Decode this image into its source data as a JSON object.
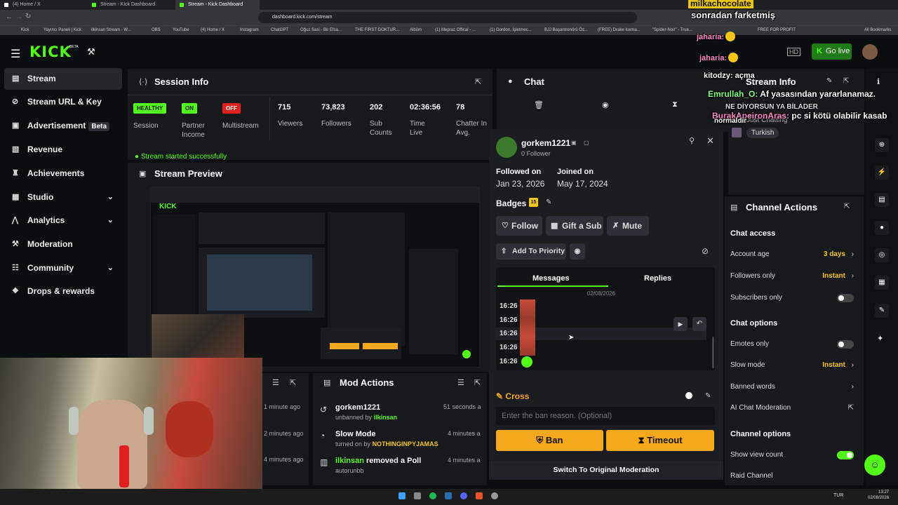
{
  "browser": {
    "tabs": [
      "(4) Home / X",
      "Stream - Kick Dashboard",
      "Stream - Kick Dashboard"
    ],
    "url": "dashboard.kick.com/stream",
    "bookmarks": [
      "Kick",
      "Yayıncı Paneli | Kick",
      "ilkinsan Stream - W...",
      "OBS",
      "YouTube",
      "(4) Home / X",
      "Instagram",
      "ChatGPT",
      "Oğuz Sasi - Bir Efsa...",
      "THE FIRST GOKTUR...",
      "Albüm",
      "(1) Mepraz Offical - ...",
      "(1) Gordon, İşletmec...",
      "BJJ Başantrenörü Öz...",
      "(FREE) Drake Icema...",
      "\"Spider-Noir\" - True...",
      "FREE FOR PROFIT",
      "All Bookmarks"
    ]
  },
  "header": {
    "logo": "KICK",
    "logo_beta": "BETA",
    "go_live": "Go live"
  },
  "sidebar": {
    "items": [
      {
        "label": "Stream",
        "icon": "stream-icon",
        "active": true
      },
      {
        "label": "Stream URL & Key",
        "icon": "link-icon"
      },
      {
        "label": "Advertisement",
        "icon": "ad-icon",
        "badge": "Beta"
      },
      {
        "label": "Revenue",
        "icon": "revenue-icon"
      },
      {
        "label": "Achievements",
        "icon": "trophy-icon"
      },
      {
        "label": "Studio",
        "icon": "studio-icon",
        "chevron": true
      },
      {
        "label": "Analytics",
        "icon": "analytics-icon",
        "chevron": true
      },
      {
        "label": "Moderation",
        "icon": "hammer-icon"
      },
      {
        "label": "Community",
        "icon": "community-icon",
        "chevron": true
      },
      {
        "label": "Drops & rewards",
        "icon": "gift-icon"
      }
    ]
  },
  "session": {
    "title": "Session Info",
    "stats": [
      {
        "pill": "HEALTHY",
        "label": "Session"
      },
      {
        "pill": "ON",
        "label": "Partner Income"
      },
      {
        "pill": "OFF",
        "label": "Multistream"
      },
      {
        "value": "715",
        "label": "Viewers"
      },
      {
        "value": "73,823",
        "label": "Followers"
      },
      {
        "value": "202",
        "label": "Sub Counts"
      },
      {
        "value": "02:36:56",
        "label": "Time Live"
      },
      {
        "value": "78",
        "label": "Chatter In Avg."
      }
    ],
    "notice": "Stream started successfully"
  },
  "preview": {
    "title": "Stream Preview"
  },
  "chat": {
    "title": "Chat"
  },
  "recent": {
    "times": [
      "1 minute ago",
      "2 minutes ago",
      "4 minutes ago"
    ]
  },
  "mod_actions": {
    "title": "Mod Actions",
    "items": [
      {
        "name": "gorkem1221",
        "detail": "unbanned by",
        "by": "ilkinsan",
        "time": "51 seconds a"
      },
      {
        "name": "Slow Mode",
        "detail": "turned on by",
        "by": "NOTHINGINPYJAMAS",
        "time": "4 minutes a"
      },
      {
        "name": "ilkinsan",
        "name_suffix": "removed a Poll",
        "detail": "autorunbb",
        "by": "",
        "time": "4 minutes a"
      }
    ]
  },
  "user_card": {
    "username": "gorkem1221",
    "followers": "0 Follower",
    "followed_label": "Followed on",
    "followed_date": "Jan 23, 2026",
    "joined_label": "Joined on",
    "joined_date": "May 17, 2024",
    "badges_label": "Badges",
    "badge_count": "15",
    "follow": "Follow",
    "gift": "Gift a Sub",
    "mute": "Mute",
    "priority": "Add To Priority",
    "tab_messages": "Messages",
    "tab_replies": "Replies",
    "date": "02/08/2026",
    "message_times": [
      "16:26",
      "16:26",
      "16:26",
      "16:26",
      "16:26"
    ],
    "cross_label": "Cross",
    "ban_placeholder": "Enter the ban reason. (Optional)",
    "ban": "Ban",
    "timeout": "Timeout",
    "switch": "Switch To Original Moderation"
  },
  "stream_info": {
    "title": "Stream Info",
    "category": "Just Chatting",
    "tag": "Turkish"
  },
  "channel_actions": {
    "title": "Channel Actions",
    "sections": [
      {
        "heading": "Chat access",
        "rows": [
          {
            "label": "Account age",
            "value": "3 days",
            "type": "arrow"
          },
          {
            "label": "Followers only",
            "value": "Instant",
            "type": "arrow"
          },
          {
            "label": "Subscribers only",
            "value": "",
            "type": "toggle",
            "on": false
          }
        ]
      },
      {
        "heading": "Chat options",
        "rows": [
          {
            "label": "Emotes only",
            "value": "",
            "type": "toggle",
            "on": false
          },
          {
            "label": "Slow mode",
            "value": "Instant",
            "type": "arrow"
          },
          {
            "label": "Banned words",
            "value": "",
            "type": "arrow"
          },
          {
            "label": "AI Chat Moderation",
            "value": "",
            "type": "external"
          }
        ]
      },
      {
        "heading": "Channel options",
        "rows": [
          {
            "label": "Show view count",
            "value": "",
            "type": "toggle",
            "on": true
          },
          {
            "label": "Raid Channel",
            "value": "",
            "type": "none"
          }
        ]
      }
    ]
  },
  "overlay_chat": [
    {
      "user": "milkachocolate",
      "text": ""
    },
    {
      "user": "",
      "text": "sonradan farketmiş"
    },
    {
      "user": "jaharia:",
      "text": ""
    },
    {
      "user": "jaharia:",
      "text": ""
    },
    {
      "user": "kitodzy:",
      "text": "açma"
    },
    {
      "user": "Emrullah_O:",
      "text": "Af yasasından yararlanamaz."
    },
    {
      "user": "",
      "text": "NE DİYORSUN YA BİLADER"
    },
    {
      "user": "BurakApeironAras:",
      "text": "pc si kötü olabilir kasab"
    },
    {
      "user": "",
      "text": "normaldir"
    }
  ],
  "taskbar": {
    "lang": "TUR",
    "time": "13:27",
    "date": "02/08/2026"
  },
  "colors": {
    "kick_green": "#53fc18",
    "yellow": "#f5a81b",
    "off_red": "#e0201f",
    "panel": "#17191c"
  }
}
